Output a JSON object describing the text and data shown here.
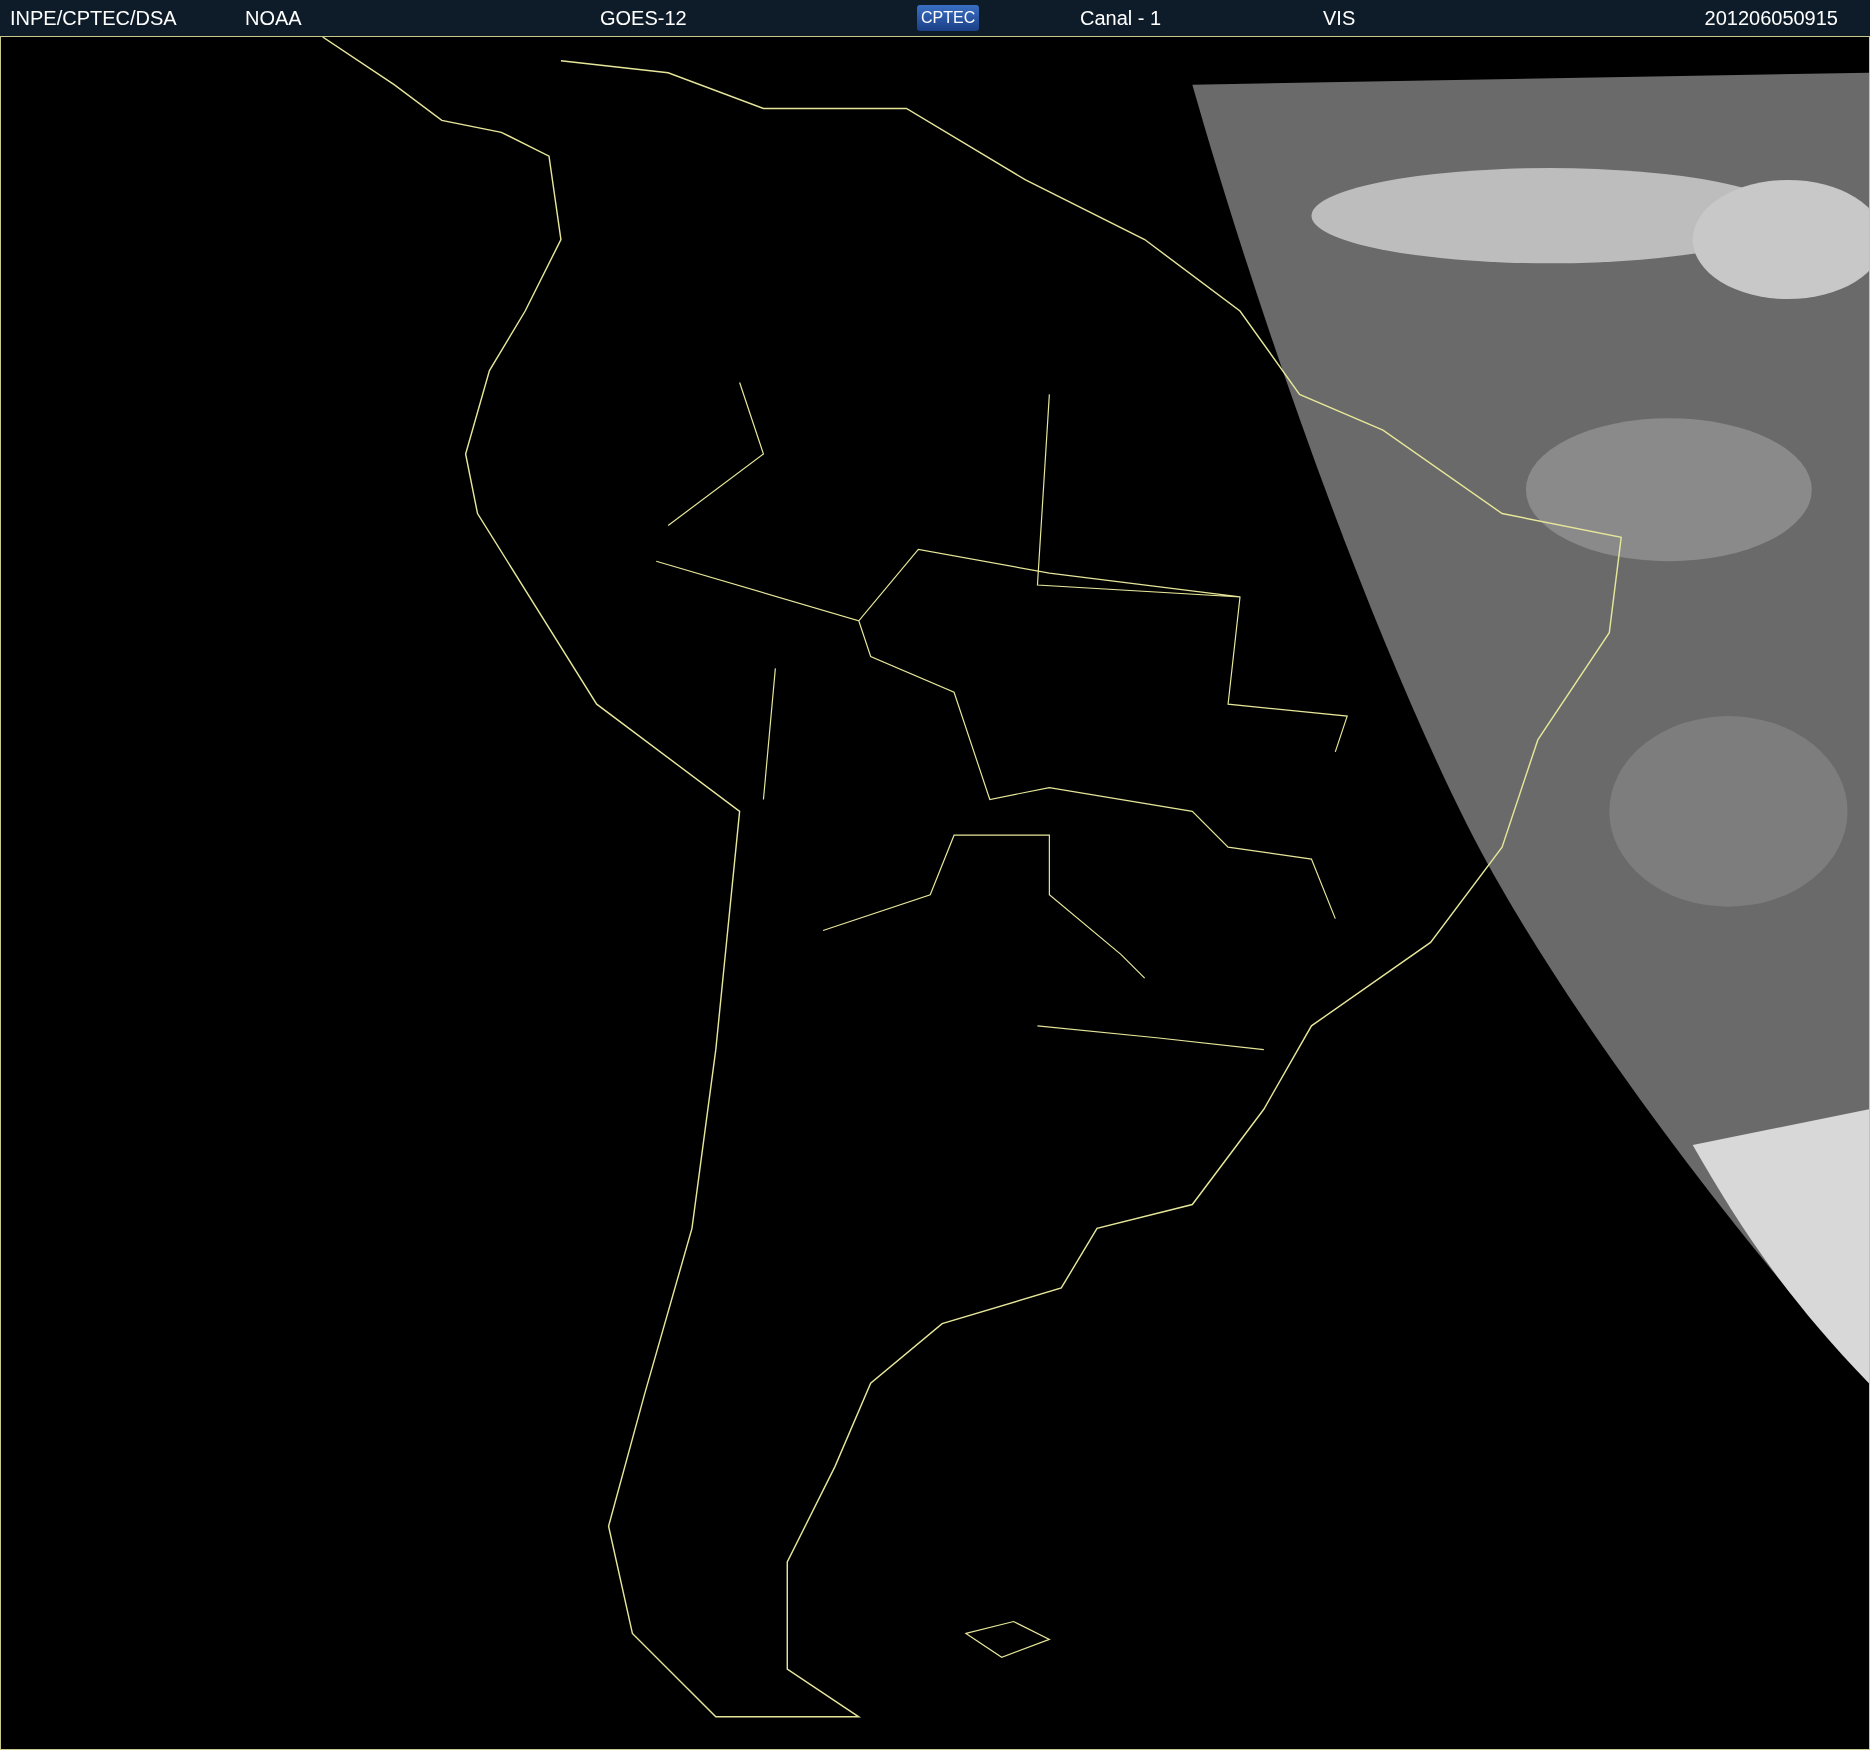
{
  "header": {
    "items": [
      {
        "kind": "text",
        "text": "INPE/CPTEC/DSA"
      },
      {
        "kind": "text",
        "text": "NOAA"
      },
      {
        "kind": "text",
        "text": "GOES-12"
      },
      {
        "kind": "logo",
        "text": "CPTEC"
      },
      {
        "kind": "text",
        "text": "Canal - 1"
      },
      {
        "kind": "text",
        "text": "VIS"
      },
      {
        "kind": "text",
        "text": "201206050915"
      }
    ]
  }
}
